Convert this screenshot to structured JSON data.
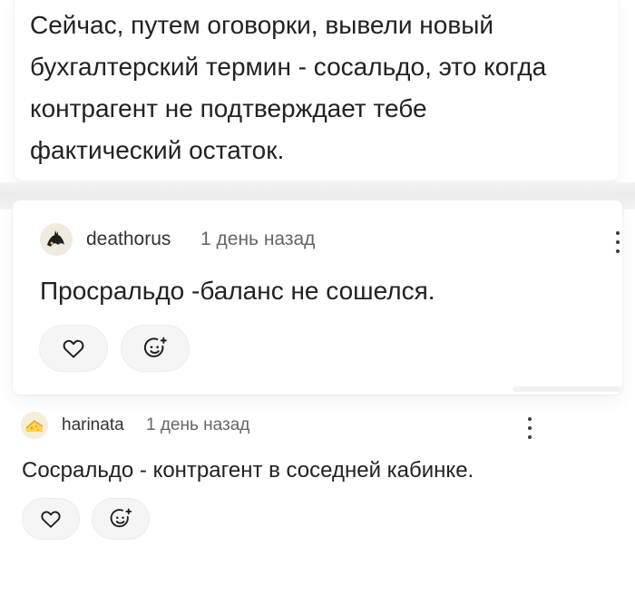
{
  "post": {
    "lines": [
      "Сейчас, путем оговорки, вывели новый",
      "бухгалтерский термин - сосальдо, это когда",
      "контрагент не подтверждает тебе",
      "фактический остаток."
    ]
  },
  "comments": [
    {
      "username": "deathorus",
      "time": "1 день назад",
      "text": "Просральдо -баланс не сошелся.",
      "icons": [
        "heart-icon",
        "add-reaction-icon",
        "more-vertical-icon"
      ]
    },
    {
      "username": "harinata",
      "time": "1 день назад",
      "text": "Сосральдо - контрагент в соседней кабинке.",
      "icons": [
        "heart-icon",
        "add-reaction-icon",
        "more-vertical-icon"
      ]
    }
  ],
  "colors": {
    "text": "#222222",
    "muted": "#666666",
    "pill": "#f5f5f5",
    "band": "#ececec"
  }
}
